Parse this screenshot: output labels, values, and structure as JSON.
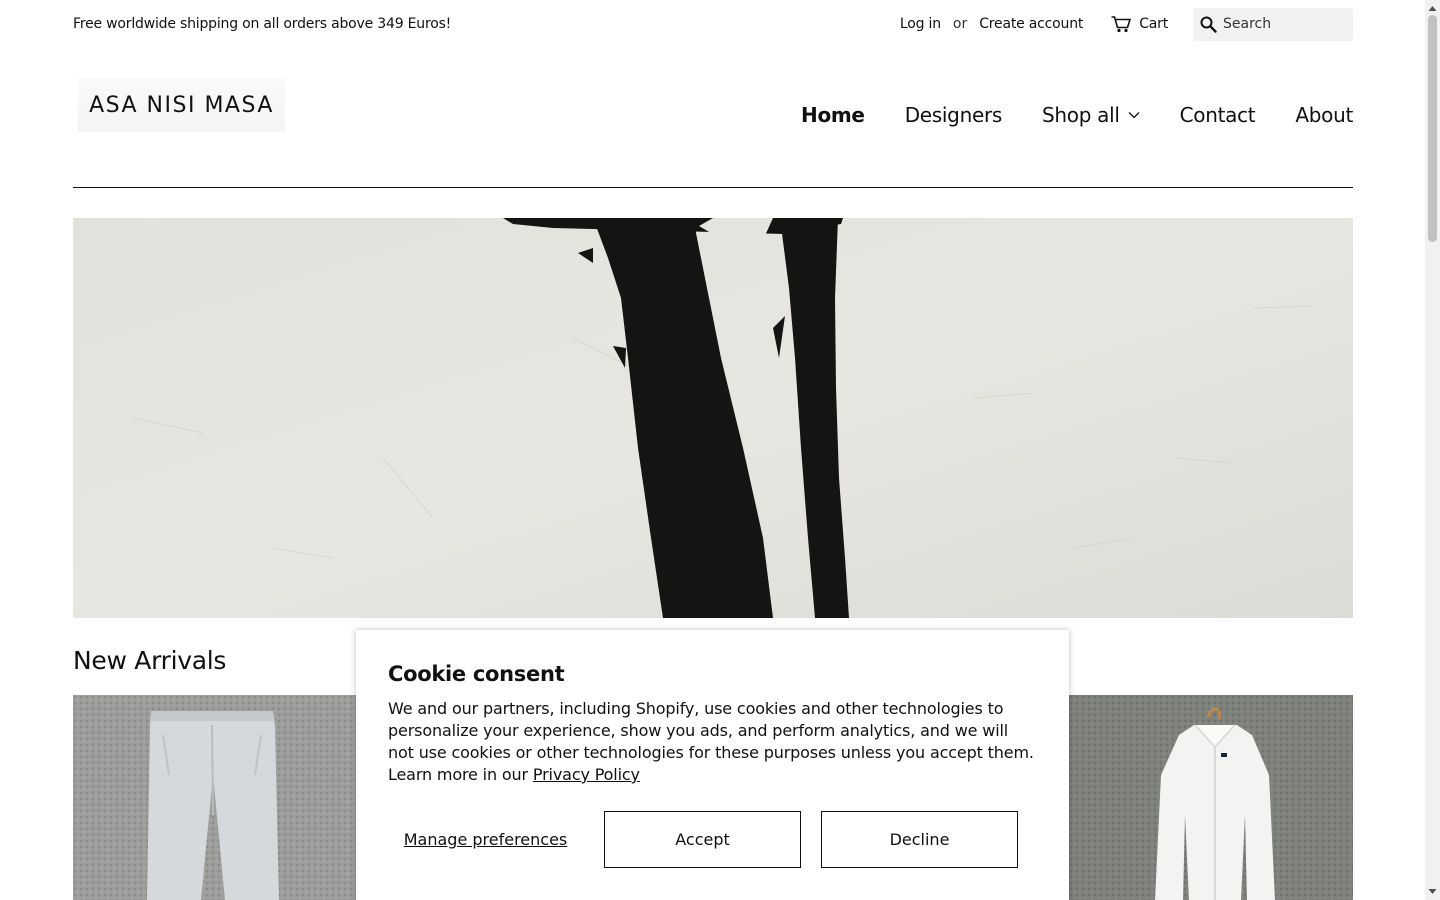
{
  "topbar": {
    "announcement": "Free worldwide shipping on all orders above 349 Euros!",
    "login": "Log in",
    "or": "or",
    "create_account": "Create account",
    "cart": "Cart",
    "search_placeholder": "Search",
    "icons": [
      "cart-icon",
      "search-icon"
    ]
  },
  "header": {
    "logo_text": "ASA NISI MASA",
    "nav": [
      {
        "label": "Home",
        "active": true
      },
      {
        "label": "Designers"
      },
      {
        "label": "Shop all",
        "dropdown": true
      },
      {
        "label": "Contact"
      },
      {
        "label": "About"
      }
    ]
  },
  "main": {
    "section_title": "New Arrivals"
  },
  "cookie": {
    "title": "Cookie consent",
    "body": "We and our partners, including Shopify, use cookies and other technologies to personalize your experience, show you ads, and perform analytics, and we will not use cookies or other technologies for these purposes unless you accept them. Learn more in our ",
    "privacy_link": "Privacy Policy",
    "manage": "Manage preferences",
    "accept": "Accept",
    "decline": "Decline"
  },
  "colors": {
    "text": "#111111",
    "search_bg": "#f2f2f2",
    "hero_bg": "#e5e3df"
  }
}
